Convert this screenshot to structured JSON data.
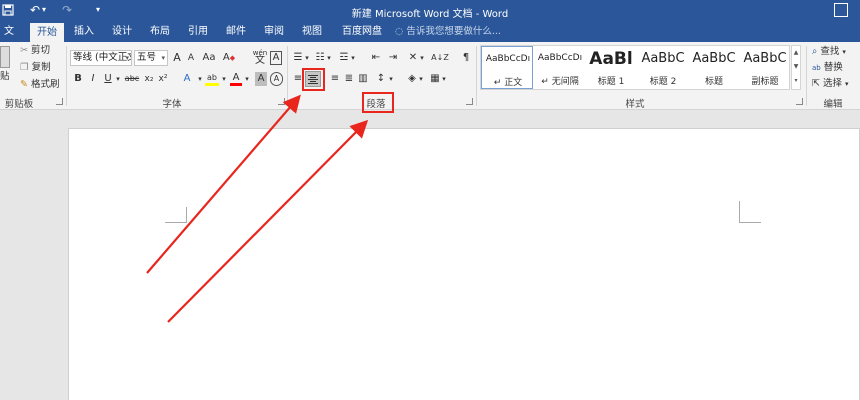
{
  "window": {
    "title": "新建 Microsoft Word 文档 - Word",
    "qat_save_icon": "save-icon",
    "qat_undo": "↶",
    "qat_redo": "↷",
    "qat_customize": "▾",
    "restore_icon": "restore-icon"
  },
  "tabs": [
    "文件",
    "开始",
    "插入",
    "设计",
    "布局",
    "引用",
    "邮件",
    "审阅",
    "视图",
    "百度网盘"
  ],
  "active_tab": "开始",
  "tell_me": "告诉我您想要做什么...",
  "clipboard": {
    "cut": "剪切",
    "copy": "复制",
    "format_painter": "格式刷",
    "paste_partial": "贴",
    "label": "剪贴板"
  },
  "font": {
    "name": "等线 (中文正文",
    "size": "五号",
    "label": "字体",
    "grow": "A",
    "shrink": "A",
    "case": "Aa",
    "clear": "A",
    "pinyin": "wén",
    "border_char": "A",
    "bold": "B",
    "italic": "I",
    "underline": "U",
    "strike": "abc",
    "subscript": "x₂",
    "superscript": "x²",
    "effects": "A",
    "highlight": "ab",
    "color": "A",
    "shading": "A",
    "enclose": "A"
  },
  "paragraph": {
    "label": "段落",
    "sort": "A↓Z"
  },
  "styles": {
    "label": "样式",
    "items": [
      {
        "preview": "AaBbCcDı",
        "name": "↵ 正文"
      },
      {
        "preview": "AaBbCcDı",
        "name": "↵ 无间隔"
      },
      {
        "preview": "AaBl",
        "name": "标题 1"
      },
      {
        "preview": "AaBbC",
        "name": "标题 2"
      },
      {
        "preview": "AaBbC",
        "name": "标题"
      },
      {
        "preview": "AaBbC",
        "name": "副标题"
      }
    ]
  },
  "editing": {
    "find": "查找",
    "replace": "替换",
    "select": "选择",
    "label": "编辑"
  },
  "colors": {
    "brand": "#2b579a",
    "annotation": "#e8261e",
    "highlight": "#ffff00",
    "font_color": "#ff0000"
  }
}
